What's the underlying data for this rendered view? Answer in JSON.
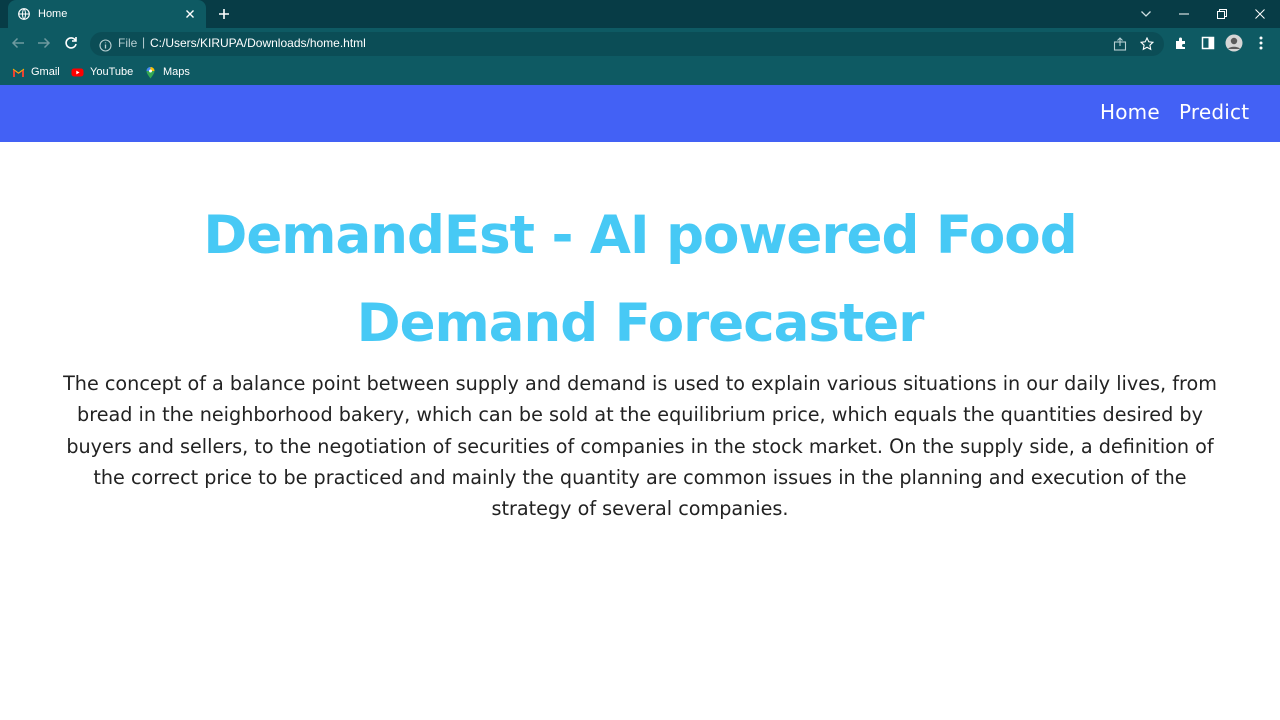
{
  "browser": {
    "tab": {
      "title": "Home",
      "favicon": "globe-icon"
    },
    "omnibox": {
      "scheme": "File",
      "separator": "|",
      "url": "C:/Users/KIRUPA/Downloads/home.html"
    },
    "bookmarks": [
      {
        "label": "Gmail",
        "icon": "gmail-icon"
      },
      {
        "label": "YouTube",
        "icon": "youtube-icon"
      },
      {
        "label": "Maps",
        "icon": "maps-icon"
      }
    ],
    "colors": {
      "tabstrip": "#073c46",
      "toolbar": "#0e5a63"
    }
  },
  "page": {
    "nav": {
      "home_label": "Home",
      "predict_label": "Predict"
    },
    "hero": {
      "title": "DemandEst - AI powered Food Demand Forecaster",
      "description": "The concept of a balance point between supply and demand is used to explain various situations in our daily lives, from bread in the neighborhood bakery, which can be sold at the equilibrium price, which equals the quantities desired by buyers and sellers, to the negotiation of securities of companies in the stock market. On the supply side, a definition of the correct price to be practiced and mainly the quantity are common issues in the planning and execution of the strategy of several companies."
    },
    "colors": {
      "navbar": "#4361f5",
      "title": "#47c9f5",
      "text": "#222222"
    }
  }
}
